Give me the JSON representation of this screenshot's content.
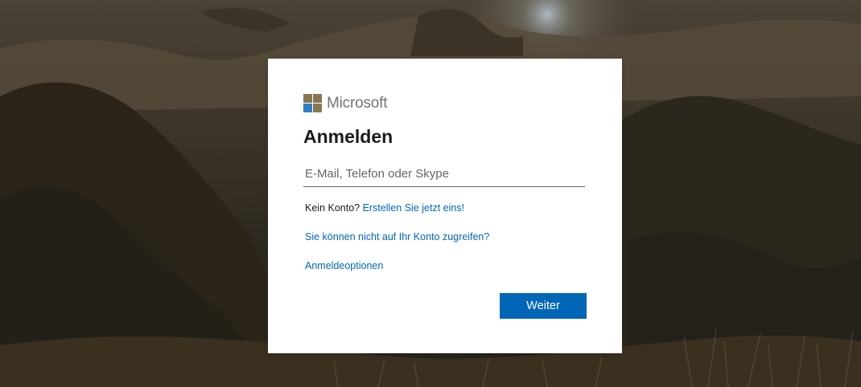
{
  "brand": {
    "name": "Microsoft",
    "colors": {
      "logo_tile": "#8a7654",
      "logo_blue": "#2f7fc1",
      "accent": "#0067b8"
    }
  },
  "signin": {
    "title": "Anmelden",
    "email_placeholder": "E-Mail, Telefon oder Skype",
    "email_value": "",
    "no_account_text": "Kein Konto?",
    "create_account_link": "Erstellen Sie jetzt eins!",
    "cant_access_link": "Sie können nicht auf Ihr Konto zugreifen?",
    "signin_options_link": "Anmeldeoptionen",
    "next_button": "Weiter"
  },
  "background": {
    "icon": "landscape-photo"
  }
}
